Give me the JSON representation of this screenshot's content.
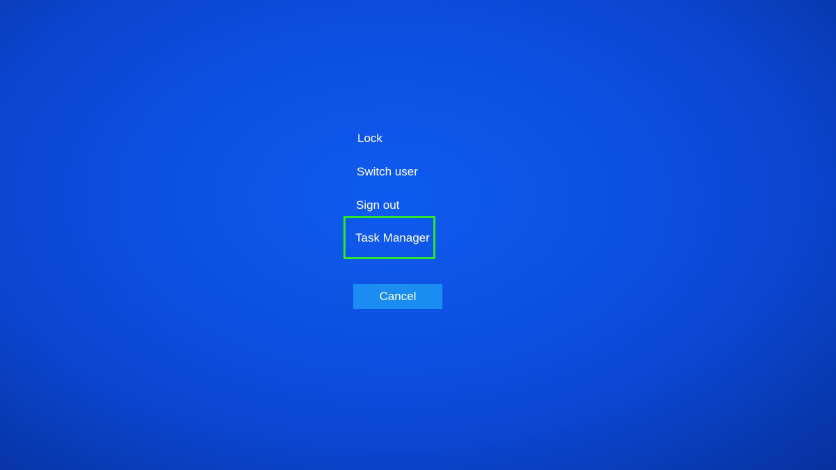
{
  "menu": {
    "items": [
      {
        "label": "Lock"
      },
      {
        "label": "Switch user"
      },
      {
        "label": "Sign out"
      },
      {
        "label": "Task Manager"
      }
    ]
  },
  "cancel": {
    "label": "Cancel"
  },
  "colors": {
    "background": "#0c4fe0",
    "text": "#ffffff",
    "button": "#1a8cf2",
    "highlight": "#2ee62b"
  }
}
